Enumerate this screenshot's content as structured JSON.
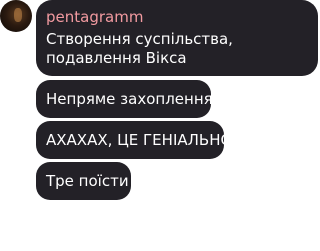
{
  "chat": {
    "username": "pentagramm",
    "messages": [
      "Створення суспільства, подавлення Вікса",
      "Непряме захоплення",
      "АХАХАХ, ЦЕ ГЕНІАЛЬНО",
      "Тре поїсти"
    ]
  },
  "colors": {
    "bubble_bg": "#232127",
    "username": "#f29aa0",
    "text": "#ffffff"
  }
}
